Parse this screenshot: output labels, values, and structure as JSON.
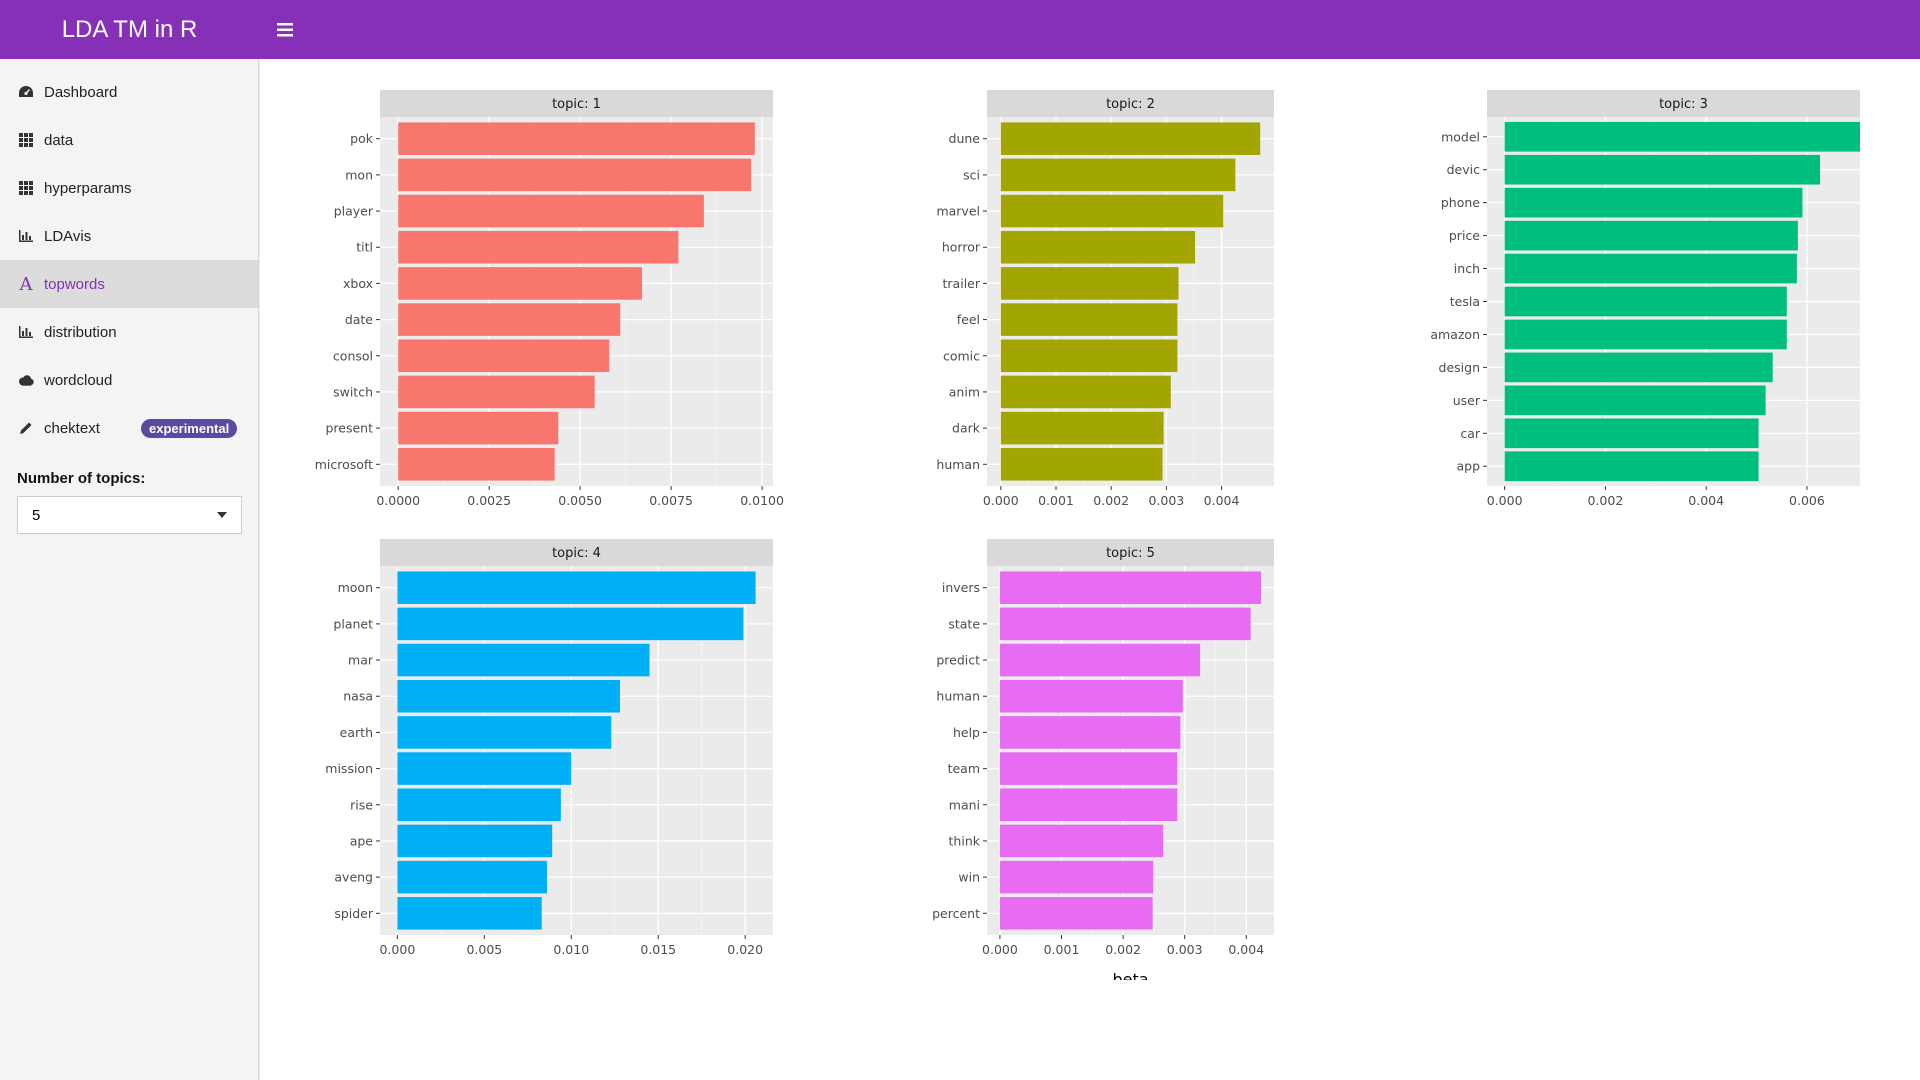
{
  "app": {
    "title": "LDA TM in R",
    "toggle_icon": "hamburger-icon"
  },
  "sidebar": {
    "items": [
      {
        "label": "Dashboard",
        "icon": "dashboard-icon"
      },
      {
        "label": "data",
        "icon": "grid-icon"
      },
      {
        "label": "hyperparams",
        "icon": "grid-icon"
      },
      {
        "label": "LDAvis",
        "icon": "bar-chart-icon"
      },
      {
        "label": "topwords",
        "icon": "font-icon",
        "active": true
      },
      {
        "label": "distribution",
        "icon": "bar-chart-icon"
      },
      {
        "label": "wordcloud",
        "icon": "cloud-icon"
      },
      {
        "label": "chektext",
        "icon": "pencil-icon",
        "badge": "experimental"
      }
    ],
    "topics_label": "Number of topics:",
    "topics_value": "5"
  },
  "chart_data": {
    "type": "bar",
    "orientation": "horizontal",
    "xlabel": "beta",
    "colors": {
      "1": "#f8766d",
      "2": "#a3a500",
      "3": "#00bf7d",
      "4": "#00b0f6",
      "5": "#e76bf3"
    },
    "facets": [
      {
        "label": "topic: 1",
        "categories": [
          "pok",
          "mon",
          "player",
          "titl",
          "xbox",
          "date",
          "consol",
          "switch",
          "present",
          "microsoft"
        ],
        "values": [
          0.0098,
          0.0097,
          0.0084,
          0.0077,
          0.0067,
          0.0061,
          0.0058,
          0.0054,
          0.0044,
          0.0043
        ],
        "xlim": [
          -0.0005,
          0.0103
        ],
        "ticks": [
          0,
          0.0025,
          0.005,
          0.0075,
          0.01
        ],
        "tick_labels": [
          "0.0000",
          "0.0025",
          "0.0050",
          "0.0075",
          "0.0100"
        ]
      },
      {
        "label": "topic: 2",
        "categories": [
          "dune",
          "sci",
          "marvel",
          "horror",
          "trailer",
          "feel",
          "comic",
          "anim",
          "dark",
          "human"
        ],
        "values": [
          0.0047,
          0.00425,
          0.00403,
          0.00352,
          0.00322,
          0.0032,
          0.0032,
          0.00308,
          0.00295,
          0.00293
        ],
        "xlim": [
          -0.00025,
          0.00495
        ],
        "ticks": [
          0,
          0.001,
          0.002,
          0.003,
          0.004
        ],
        "tick_labels": [
          "0.000",
          "0.001",
          "0.002",
          "0.003",
          "0.004"
        ]
      },
      {
        "label": "topic: 3",
        "categories": [
          "model",
          "devic",
          "phone",
          "price",
          "inch",
          "tesla",
          "amazon",
          "design",
          "user",
          "car",
          "app"
        ],
        "values": [
          0.0071,
          0.00626,
          0.00591,
          0.00582,
          0.0058,
          0.0056,
          0.0056,
          0.00532,
          0.00518,
          0.00504,
          0.00504
        ],
        "xlim": [
          -0.00035,
          0.00745
        ],
        "ticks": [
          0,
          0.002,
          0.004,
          0.006
        ],
        "tick_labels": [
          "0.000",
          "0.002",
          "0.004",
          "0.006"
        ]
      },
      {
        "label": "topic: 4",
        "categories": [
          "moon",
          "planet",
          "mar",
          "nasa",
          "earth",
          "mission",
          "rise",
          "ape",
          "aveng",
          "spider"
        ],
        "values": [
          0.0206,
          0.0199,
          0.0145,
          0.0128,
          0.0123,
          0.01,
          0.0094,
          0.0089,
          0.0086,
          0.0083
        ],
        "xlim": [
          -0.001,
          0.0216
        ],
        "ticks": [
          0,
          0.005,
          0.01,
          0.015,
          0.02
        ],
        "tick_labels": [
          "0.000",
          "0.005",
          "0.010",
          "0.015",
          "0.020"
        ]
      },
      {
        "label": "topic: 5",
        "categories": [
          "invers",
          "state",
          "predict",
          "human",
          "help",
          "team",
          "mani",
          "think",
          "win",
          "percent"
        ],
        "values": [
          0.00424,
          0.00407,
          0.00325,
          0.00297,
          0.00293,
          0.00288,
          0.00288,
          0.00265,
          0.00249,
          0.00248
        ],
        "xlim": [
          -0.00021,
          0.00445
        ],
        "ticks": [
          0,
          0.001,
          0.002,
          0.003,
          0.004
        ],
        "tick_labels": [
          "0.000",
          "0.001",
          "0.002",
          "0.003",
          "0.004"
        ]
      }
    ]
  }
}
